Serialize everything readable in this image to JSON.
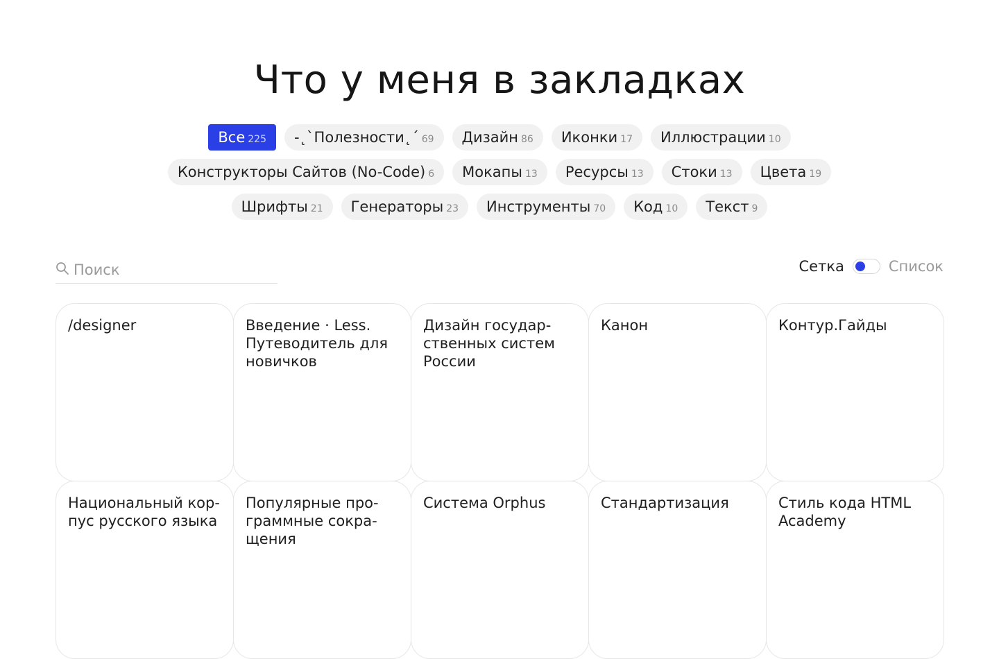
{
  "page": {
    "title": "Что у меня в закладках"
  },
  "tags": [
    [
      {
        "label": "Все",
        "count": "225",
        "active": true
      },
      {
        "label": "-˛`Полезности˛´",
        "count": "69"
      },
      {
        "label": "Дизайн",
        "count": "86"
      },
      {
        "label": "Иконки",
        "count": "17"
      },
      {
        "label": "Иллюстрации",
        "count": "10"
      }
    ],
    [
      {
        "label": "Конструкторы Сайтов (No-Code)",
        "count": "6"
      },
      {
        "label": "Мокапы",
        "count": "13"
      },
      {
        "label": "Ресурсы",
        "count": "13"
      },
      {
        "label": "Стоки",
        "count": "13"
      },
      {
        "label": "Цвета",
        "count": "19"
      }
    ],
    [
      {
        "label": "Шрифты",
        "count": "21"
      },
      {
        "label": "Генераторы",
        "count": "23"
      },
      {
        "label": "Инструменты",
        "count": "70"
      },
      {
        "label": "Код",
        "count": "10"
      },
      {
        "label": "Текст",
        "count": "9"
      }
    ]
  ],
  "search": {
    "placeholder": "Поиск",
    "value": ""
  },
  "view": {
    "grid_label": "Сетка",
    "list_label": "Список",
    "mode": "grid"
  },
  "colors": {
    "accent": "#2b3fe6"
  },
  "cards": [
    "/designer",
    "Введение · Less. Путеводитель для новичков",
    "Дизайн государ-ственных систем России",
    "Канон",
    "Контур.Гайды",
    "Национальный кор-пус русского языка",
    "Популярные про-граммные сокра-щения",
    "Система Orphus",
    "Стандартизация",
    "Стиль кода HTML Academy"
  ]
}
